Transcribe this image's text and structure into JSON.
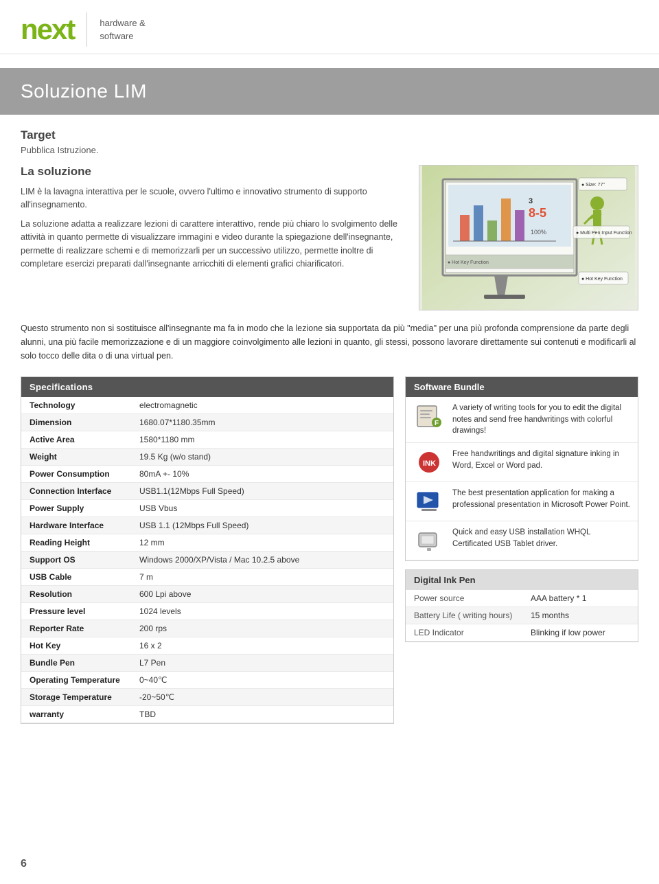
{
  "header": {
    "logo": "next",
    "subtitle_line1": "hardware &",
    "subtitle_line2": "software"
  },
  "title_banner": {
    "title": "Soluzione LIM"
  },
  "target": {
    "label": "Target",
    "pubblica": "Pubblica Istruzione."
  },
  "la_soluzione": {
    "heading": "La soluzione",
    "paragraph1": "LIM è la lavagna interattiva per le scuole, ovvero l'ultimo e innovativo strumento di supporto all'insegnamento.",
    "paragraph2": "La soluzione adatta a realizzare lezioni di carattere interattivo, rende più chiaro lo svolgimento delle attività in quanto permette di visualizzare immagini e video durante la spiegazione dell'insegnante, permette di realizzare schemi e di memorizzarli per un successivo utilizzo, permette inoltre di completare esercizi preparati dall'insegnante arricchiti di elementi grafici chiarificatori."
  },
  "full_paragraph": "Questo strumento non si sostituisce all'insegnante ma fa in modo che la lezione sia supportata da più \"media\" per una più profonda comprensione da parte degli alunni, una più facile memorizzazione e di un maggiore coinvolgimento alle lezioni in quanto, gli stessi, possono lavorare direttamente sui contenuti e modificarli al solo tocco delle dita o di una virtual pen.",
  "specifications": {
    "header": "Specifications",
    "rows": [
      {
        "label": "Technology",
        "value": "electromagnetic"
      },
      {
        "label": "Dimension",
        "value": "1680.07*1180.35mm"
      },
      {
        "label": "Active Area",
        "value": "1580*1180 mm"
      },
      {
        "label": "Weight",
        "value": "19.5 Kg (w/o stand)"
      },
      {
        "label": "Power Consumption",
        "value": "80mA +- 10%"
      },
      {
        "label": "Connection Interface",
        "value": "USB1.1(12Mbps Full Speed)"
      },
      {
        "label": "Power Supply",
        "value": "USB Vbus"
      },
      {
        "label": "Hardware Interface",
        "value": "USB 1.1 (12Mbps Full Speed)"
      },
      {
        "label": "Reading Height",
        "value": "12 mm"
      },
      {
        "label": "Support OS",
        "value": "Windows 2000/XP/Vista / Mac 10.2.5 above"
      },
      {
        "label": "USB Cable",
        "value": "7 m"
      },
      {
        "label": "Resolution",
        "value": "600 Lpi above"
      },
      {
        "label": "Pressure level",
        "value": "1024 levels"
      },
      {
        "label": "Reporter Rate",
        "value": "200 rps"
      },
      {
        "label": "Hot Key",
        "value": "16 x 2"
      },
      {
        "label": "Bundle Pen",
        "value": "L7 Pen"
      },
      {
        "label": "Operating Temperature",
        "value": "0~40℃"
      },
      {
        "label": "Storage Temperature",
        "value": "-20~50℃"
      },
      {
        "label": "warranty",
        "value": "TBD"
      }
    ]
  },
  "software_bundle": {
    "header": "Software Bundle",
    "items": [
      {
        "icon": "notes-icon",
        "text": "A variety of writing tools for you to edit the digital notes and send free handwritings with colorful drawings!"
      },
      {
        "icon": "office-ink-icon",
        "text": "Free handwritings and digital signature inking in Word, Excel or Word pad."
      },
      {
        "icon": "power-presenter-icon",
        "text": "The best presentation application for making a professional presentation in Microsoft Power Point."
      },
      {
        "icon": "tablet-driver-icon",
        "text": "Quick and easy USB installation\nWHQL Certificated USB Tablet driver."
      }
    ]
  },
  "digital_ink_pen": {
    "header": "Digital Ink Pen",
    "rows": [
      {
        "label": "Power source",
        "value": "AAA battery * 1"
      },
      {
        "label": "Battery Life ( writing hours)",
        "value": "15 months"
      },
      {
        "label": "LED Indicator",
        "value": "Blinking if low power"
      }
    ]
  },
  "page_number": "6"
}
